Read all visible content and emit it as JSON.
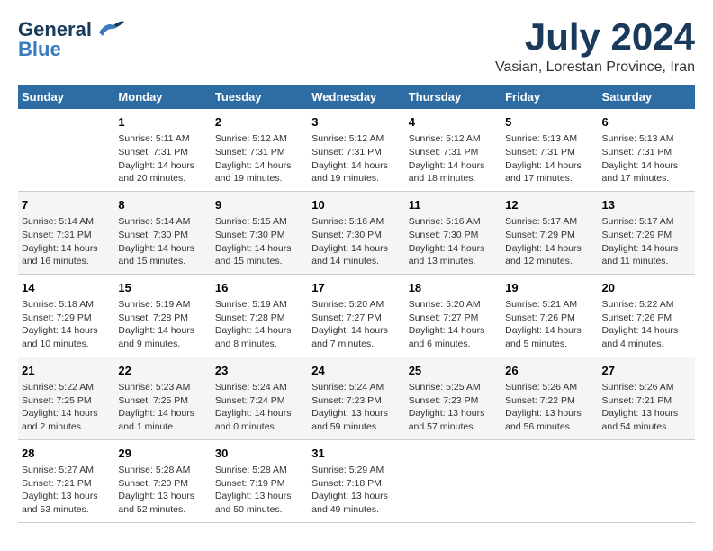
{
  "header": {
    "logo_line1": "General",
    "logo_line2": "Blue",
    "month": "July 2024",
    "location": "Vasian, Lorestan Province, Iran"
  },
  "days_of_week": [
    "Sunday",
    "Monday",
    "Tuesday",
    "Wednesday",
    "Thursday",
    "Friday",
    "Saturday"
  ],
  "weeks": [
    [
      {
        "day": "",
        "info": ""
      },
      {
        "day": "1",
        "info": "Sunrise: 5:11 AM\nSunset: 7:31 PM\nDaylight: 14 hours\nand 20 minutes."
      },
      {
        "day": "2",
        "info": "Sunrise: 5:12 AM\nSunset: 7:31 PM\nDaylight: 14 hours\nand 19 minutes."
      },
      {
        "day": "3",
        "info": "Sunrise: 5:12 AM\nSunset: 7:31 PM\nDaylight: 14 hours\nand 19 minutes."
      },
      {
        "day": "4",
        "info": "Sunrise: 5:12 AM\nSunset: 7:31 PM\nDaylight: 14 hours\nand 18 minutes."
      },
      {
        "day": "5",
        "info": "Sunrise: 5:13 AM\nSunset: 7:31 PM\nDaylight: 14 hours\nand 17 minutes."
      },
      {
        "day": "6",
        "info": "Sunrise: 5:13 AM\nSunset: 7:31 PM\nDaylight: 14 hours\nand 17 minutes."
      }
    ],
    [
      {
        "day": "7",
        "info": "Sunrise: 5:14 AM\nSunset: 7:31 PM\nDaylight: 14 hours\nand 16 minutes."
      },
      {
        "day": "8",
        "info": "Sunrise: 5:14 AM\nSunset: 7:30 PM\nDaylight: 14 hours\nand 15 minutes."
      },
      {
        "day": "9",
        "info": "Sunrise: 5:15 AM\nSunset: 7:30 PM\nDaylight: 14 hours\nand 15 minutes."
      },
      {
        "day": "10",
        "info": "Sunrise: 5:16 AM\nSunset: 7:30 PM\nDaylight: 14 hours\nand 14 minutes."
      },
      {
        "day": "11",
        "info": "Sunrise: 5:16 AM\nSunset: 7:30 PM\nDaylight: 14 hours\nand 13 minutes."
      },
      {
        "day": "12",
        "info": "Sunrise: 5:17 AM\nSunset: 7:29 PM\nDaylight: 14 hours\nand 12 minutes."
      },
      {
        "day": "13",
        "info": "Sunrise: 5:17 AM\nSunset: 7:29 PM\nDaylight: 14 hours\nand 11 minutes."
      }
    ],
    [
      {
        "day": "14",
        "info": "Sunrise: 5:18 AM\nSunset: 7:29 PM\nDaylight: 14 hours\nand 10 minutes."
      },
      {
        "day": "15",
        "info": "Sunrise: 5:19 AM\nSunset: 7:28 PM\nDaylight: 14 hours\nand 9 minutes."
      },
      {
        "day": "16",
        "info": "Sunrise: 5:19 AM\nSunset: 7:28 PM\nDaylight: 14 hours\nand 8 minutes."
      },
      {
        "day": "17",
        "info": "Sunrise: 5:20 AM\nSunset: 7:27 PM\nDaylight: 14 hours\nand 7 minutes."
      },
      {
        "day": "18",
        "info": "Sunrise: 5:20 AM\nSunset: 7:27 PM\nDaylight: 14 hours\nand 6 minutes."
      },
      {
        "day": "19",
        "info": "Sunrise: 5:21 AM\nSunset: 7:26 PM\nDaylight: 14 hours\nand 5 minutes."
      },
      {
        "day": "20",
        "info": "Sunrise: 5:22 AM\nSunset: 7:26 PM\nDaylight: 14 hours\nand 4 minutes."
      }
    ],
    [
      {
        "day": "21",
        "info": "Sunrise: 5:22 AM\nSunset: 7:25 PM\nDaylight: 14 hours\nand 2 minutes."
      },
      {
        "day": "22",
        "info": "Sunrise: 5:23 AM\nSunset: 7:25 PM\nDaylight: 14 hours\nand 1 minute."
      },
      {
        "day": "23",
        "info": "Sunrise: 5:24 AM\nSunset: 7:24 PM\nDaylight: 14 hours\nand 0 minutes."
      },
      {
        "day": "24",
        "info": "Sunrise: 5:24 AM\nSunset: 7:23 PM\nDaylight: 13 hours\nand 59 minutes."
      },
      {
        "day": "25",
        "info": "Sunrise: 5:25 AM\nSunset: 7:23 PM\nDaylight: 13 hours\nand 57 minutes."
      },
      {
        "day": "26",
        "info": "Sunrise: 5:26 AM\nSunset: 7:22 PM\nDaylight: 13 hours\nand 56 minutes."
      },
      {
        "day": "27",
        "info": "Sunrise: 5:26 AM\nSunset: 7:21 PM\nDaylight: 13 hours\nand 54 minutes."
      }
    ],
    [
      {
        "day": "28",
        "info": "Sunrise: 5:27 AM\nSunset: 7:21 PM\nDaylight: 13 hours\nand 53 minutes."
      },
      {
        "day": "29",
        "info": "Sunrise: 5:28 AM\nSunset: 7:20 PM\nDaylight: 13 hours\nand 52 minutes."
      },
      {
        "day": "30",
        "info": "Sunrise: 5:28 AM\nSunset: 7:19 PM\nDaylight: 13 hours\nand 50 minutes."
      },
      {
        "day": "31",
        "info": "Sunrise: 5:29 AM\nSunset: 7:18 PM\nDaylight: 13 hours\nand 49 minutes."
      },
      {
        "day": "",
        "info": ""
      },
      {
        "day": "",
        "info": ""
      },
      {
        "day": "",
        "info": ""
      }
    ]
  ]
}
